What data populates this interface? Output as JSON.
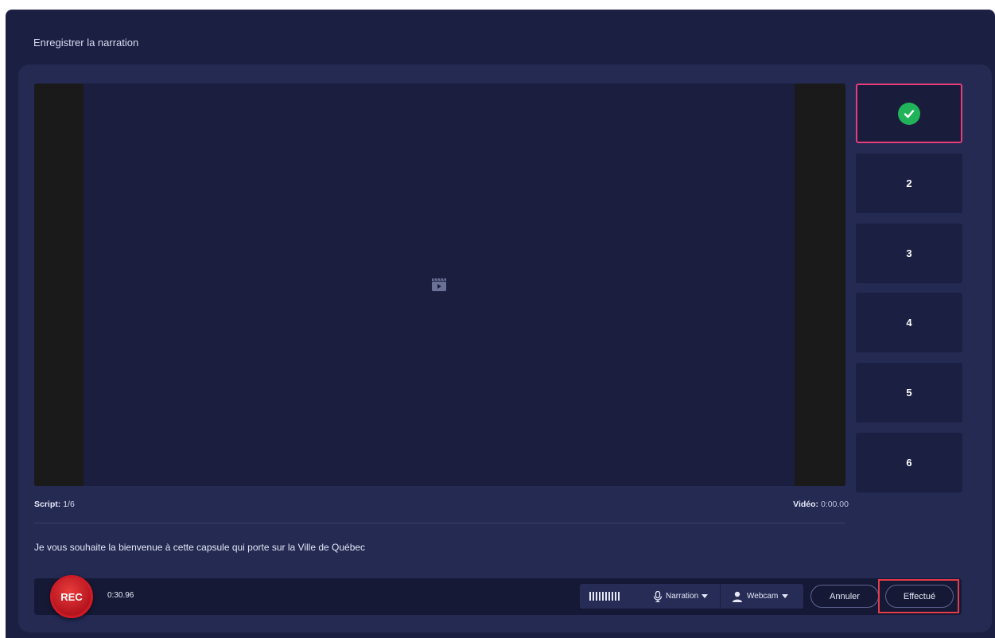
{
  "dialog": {
    "title": "Enregistrer la narration"
  },
  "slides": [
    {
      "label": "",
      "done": true
    },
    {
      "label": "2"
    },
    {
      "label": "3"
    },
    {
      "label": "4"
    },
    {
      "label": "5"
    },
    {
      "label": "6"
    }
  ],
  "meta": {
    "script_label": "Script:",
    "script_value": "1/6",
    "video_label": "Vidéo:",
    "video_value": "0:00.00"
  },
  "script_text": "Je vous souhaite la bienvenue à cette capsule qui porte sur la Ville de Québec",
  "recorder": {
    "rec_label": "REC",
    "timer": "0:30.96",
    "audio_level": 1.0,
    "narration_label": "Narration",
    "webcam_label": "Webcam",
    "cancel_label": "Annuler",
    "done_label": "Effectué"
  },
  "colors": {
    "active_slide_border": "#e63c7b",
    "check": "#21b35a",
    "rec": "#d11a26",
    "highlight": "#e33b4a"
  }
}
